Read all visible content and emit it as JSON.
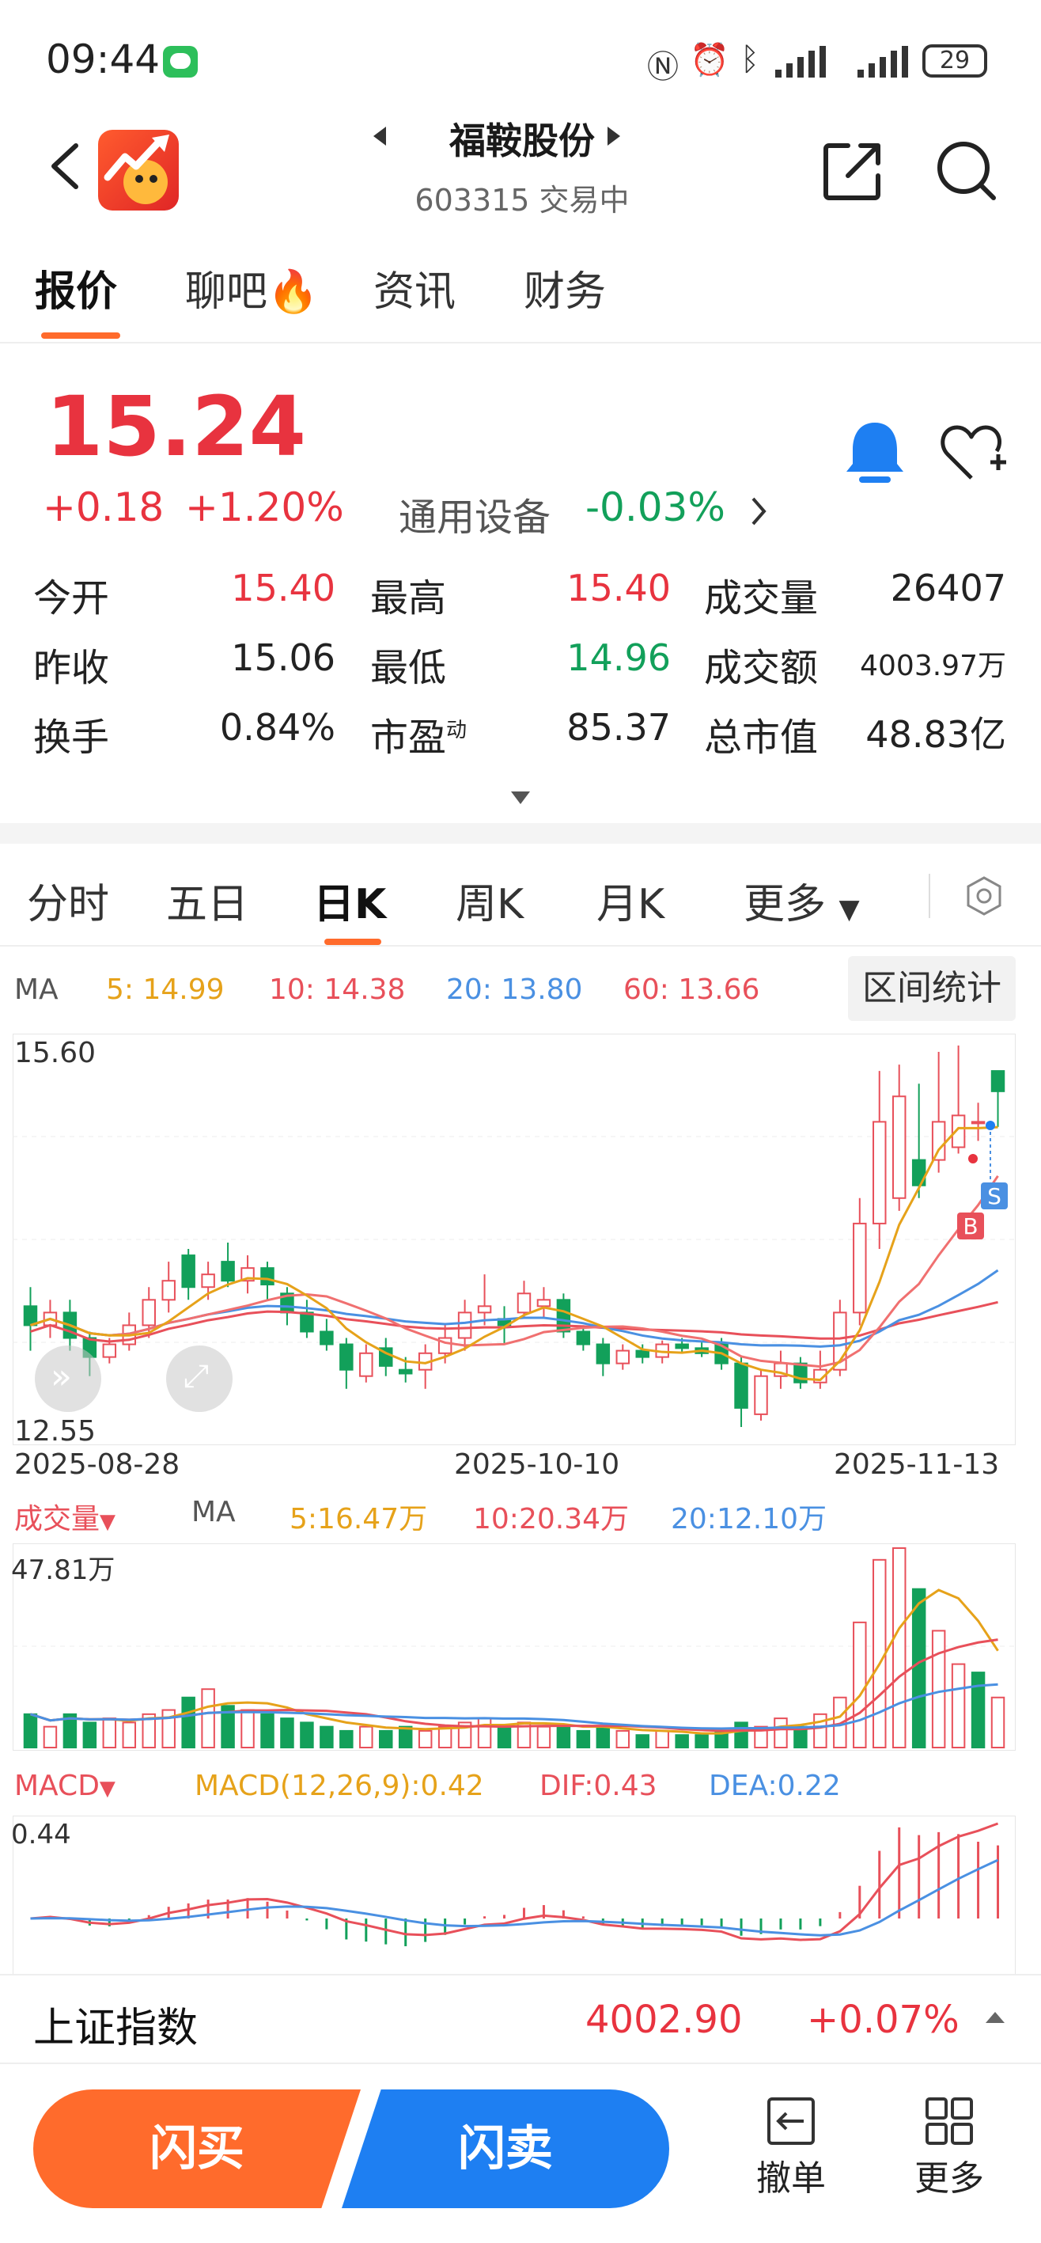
{
  "status_bar": {
    "time": "09:44",
    "battery": "29"
  },
  "header": {
    "stock_name": "福鞍股份",
    "stock_code_status": "603315 交易中"
  },
  "tabs": [
    {
      "label": "报价"
    },
    {
      "label": "聊吧"
    },
    {
      "label": "资讯"
    },
    {
      "label": "财务"
    }
  ],
  "quote": {
    "price": "15.24",
    "change": "+0.18",
    "change_pct": "+1.20%",
    "sector": "通用设备",
    "sector_pct": "-0.03%",
    "rows": [
      {
        "l1": "今开",
        "v1": "15.40",
        "l2": "最高",
        "v2": "15.40",
        "l3": "成交量",
        "v3": "26407"
      },
      {
        "l1": "昨收",
        "v1": "15.06",
        "l2": "最低",
        "v2": "14.96",
        "l3": "成交额",
        "v3": "4003.97万"
      },
      {
        "l1": "换手",
        "v1": "0.84%",
        "l2": "市盈",
        "l2sup": "动",
        "v2": "85.37",
        "l3": "总市值",
        "v3": "48.83亿"
      }
    ]
  },
  "period_tabs": [
    {
      "label": "分时"
    },
    {
      "label": "五日"
    },
    {
      "label": "日K"
    },
    {
      "label": "周K"
    },
    {
      "label": "月K"
    },
    {
      "label": "更多"
    }
  ],
  "ma": {
    "title": "MA",
    "ma5": "5:  14.99",
    "ma10": "10:  14.38",
    "ma20": "20:  13.80",
    "ma60": "60:  13.66"
  },
  "range_stats": "区间统计",
  "kline": {
    "y_top": "15.60",
    "y_bottom": "12.55",
    "dates": [
      "2025-08-28",
      "2025-10-10",
      "2025-11-13"
    ],
    "marker_b": "B",
    "marker_s": "S"
  },
  "volume": {
    "title": "成交量",
    "ma_title": "MA",
    "ma5": "5:16.47万",
    "ma10": "10:20.34万",
    "ma20": "20:12.10万",
    "y_top": "47.81万"
  },
  "macd": {
    "title": "MACD",
    "params": "MACD(12,26,9):0.42",
    "dif": "DIF:0.43",
    "dea": "DEA:0.22",
    "y_top": "0.44"
  },
  "index_bar": {
    "name": "上证指数",
    "value": "4002.90",
    "pct": "+0.07%"
  },
  "bottom": {
    "buy": "闪买",
    "sell": "闪卖",
    "cancel": "撤单",
    "more": "更多"
  },
  "colors": {
    "up": "#e8333f",
    "down": "#12a05a",
    "accent": "#ff6b2c",
    "blue": "#1e7ff2"
  },
  "chart_data": {
    "type": "candlestick",
    "ylim": [
      12.55,
      15.6
    ],
    "candles": [
      {
        "o": 13.55,
        "c": 13.4,
        "h": 13.7,
        "l": 13.2
      },
      {
        "o": 13.4,
        "c": 13.5,
        "h": 13.6,
        "l": 13.3
      },
      {
        "o": 13.5,
        "c": 13.3,
        "h": 13.6,
        "l": 13.2
      },
      {
        "o": 13.3,
        "c": 13.15,
        "h": 13.35,
        "l": 13.0
      },
      {
        "o": 13.15,
        "c": 13.25,
        "h": 13.3,
        "l": 13.1
      },
      {
        "o": 13.25,
        "c": 13.4,
        "h": 13.5,
        "l": 13.2
      },
      {
        "o": 13.4,
        "c": 13.6,
        "h": 13.7,
        "l": 13.3
      },
      {
        "o": 13.6,
        "c": 13.75,
        "h": 13.9,
        "l": 13.5
      },
      {
        "o": 13.95,
        "c": 13.7,
        "h": 14.0,
        "l": 13.6
      },
      {
        "o": 13.7,
        "c": 13.8,
        "h": 13.9,
        "l": 13.6
      },
      {
        "o": 13.9,
        "c": 13.75,
        "h": 14.05,
        "l": 13.7
      },
      {
        "o": 13.75,
        "c": 13.85,
        "h": 13.95,
        "l": 13.65
      },
      {
        "o": 13.85,
        "c": 13.72,
        "h": 13.9,
        "l": 13.6
      },
      {
        "o": 13.65,
        "c": 13.5,
        "h": 13.7,
        "l": 13.4
      },
      {
        "o": 13.5,
        "c": 13.35,
        "h": 13.6,
        "l": 13.3
      },
      {
        "o": 13.35,
        "c": 13.25,
        "h": 13.45,
        "l": 13.2
      },
      {
        "o": 13.25,
        "c": 13.05,
        "h": 13.3,
        "l": 12.9
      },
      {
        "o": 13.0,
        "c": 13.18,
        "h": 13.25,
        "l": 12.95
      },
      {
        "o": 13.22,
        "c": 13.08,
        "h": 13.3,
        "l": 13.0
      },
      {
        "o": 13.05,
        "c": 13.02,
        "h": 13.15,
        "l": 12.95
      },
      {
        "o": 13.05,
        "c": 13.18,
        "h": 13.25,
        "l": 12.9
      },
      {
        "o": 13.18,
        "c": 13.3,
        "h": 13.4,
        "l": 13.1
      },
      {
        "o": 13.3,
        "c": 13.5,
        "h": 13.6,
        "l": 13.2
      },
      {
        "o": 13.5,
        "c": 13.55,
        "h": 13.8,
        "l": 13.4
      },
      {
        "o": 13.45,
        "c": 13.4,
        "h": 13.55,
        "l": 13.25
      },
      {
        "o": 13.5,
        "c": 13.65,
        "h": 13.75,
        "l": 13.45
      },
      {
        "o": 13.55,
        "c": 13.6,
        "h": 13.7,
        "l": 13.45
      },
      {
        "o": 13.6,
        "c": 13.35,
        "h": 13.65,
        "l": 13.3
      },
      {
        "o": 13.35,
        "c": 13.25,
        "h": 13.4,
        "l": 13.2
      },
      {
        "o": 13.25,
        "c": 13.1,
        "h": 13.3,
        "l": 13.0
      },
      {
        "o": 13.1,
        "c": 13.2,
        "h": 13.25,
        "l": 13.05
      },
      {
        "o": 13.2,
        "c": 13.15,
        "h": 13.25,
        "l": 13.1
      },
      {
        "o": 13.15,
        "c": 13.25,
        "h": 13.28,
        "l": 13.1
      },
      {
        "o": 13.25,
        "c": 13.22,
        "h": 13.3,
        "l": 13.18
      },
      {
        "o": 13.22,
        "c": 13.18,
        "h": 13.28,
        "l": 13.15
      },
      {
        "o": 13.25,
        "c": 13.1,
        "h": 13.3,
        "l": 13.05
      },
      {
        "o": 13.1,
        "c": 12.75,
        "h": 13.15,
        "l": 12.6
      },
      {
        "o": 12.7,
        "c": 13.0,
        "h": 13.05,
        "l": 12.65
      },
      {
        "o": 13.0,
        "c": 13.1,
        "h": 13.2,
        "l": 12.9
      },
      {
        "o": 13.1,
        "c": 12.95,
        "h": 13.15,
        "l": 12.9
      },
      {
        "o": 12.95,
        "c": 13.05,
        "h": 13.2,
        "l": 12.9
      },
      {
        "o": 13.05,
        "c": 13.5,
        "h": 13.6,
        "l": 13.0
      },
      {
        "o": 13.5,
        "c": 14.2,
        "h": 14.4,
        "l": 13.4
      },
      {
        "o": 14.2,
        "c": 15.0,
        "h": 15.4,
        "l": 14.0
      },
      {
        "o": 14.4,
        "c": 15.2,
        "h": 15.45,
        "l": 14.3
      },
      {
        "o": 14.7,
        "c": 14.5,
        "h": 15.3,
        "l": 14.4
      },
      {
        "o": 14.7,
        "c": 15.0,
        "h": 15.55,
        "l": 14.6
      },
      {
        "o": 14.8,
        "c": 15.05,
        "h": 15.6,
        "l": 14.75
      },
      {
        "o": 15.0,
        "c": 15.0,
        "h": 15.15,
        "l": 14.85
      },
      {
        "o": 15.4,
        "c": 15.24,
        "h": 15.4,
        "l": 14.96
      }
    ],
    "volume": [
      8,
      5,
      8,
      6,
      7,
      6,
      8,
      9,
      12,
      14,
      10,
      9,
      8,
      7,
      6,
      5,
      4,
      5,
      4,
      5,
      4,
      5,
      6,
      7,
      5,
      6,
      5,
      5,
      4,
      5,
      4,
      3,
      4,
      3,
      3,
      4,
      6,
      5,
      7,
      5,
      8,
      12,
      30,
      45,
      47.81,
      38,
      28,
      20,
      18,
      12
    ],
    "volume_up": [
      false,
      true,
      false,
      false,
      true,
      true,
      true,
      true,
      false,
      true,
      false,
      true,
      false,
      false,
      false,
      false,
      false,
      true,
      false,
      false,
      true,
      true,
      true,
      true,
      false,
      true,
      true,
      false,
      false,
      false,
      true,
      false,
      true,
      false,
      false,
      false,
      false,
      true,
      true,
      false,
      true,
      true,
      true,
      true,
      true,
      false,
      true,
      true,
      false,
      true
    ]
  }
}
